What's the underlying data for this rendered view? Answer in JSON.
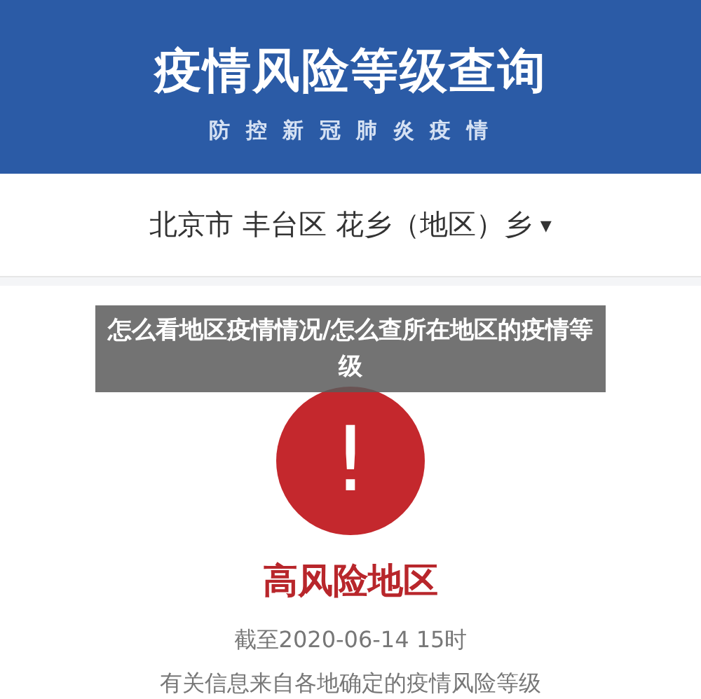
{
  "header": {
    "title": "疫情风险等级查询",
    "subtitle": "防 控 新 冠 肺 炎 疫 情"
  },
  "location": {
    "text": "北京市 丰台区 花乡（地区）乡",
    "caret": "▾"
  },
  "result": {
    "mark": "!",
    "level": "高风险地区",
    "as_of": "截至2020-06-14 15时",
    "note": "有关信息来自各地确定的疫情风险等级"
  },
  "caption": "怎么看地区疫情情况/怎么查所在地区的疫情等级"
}
